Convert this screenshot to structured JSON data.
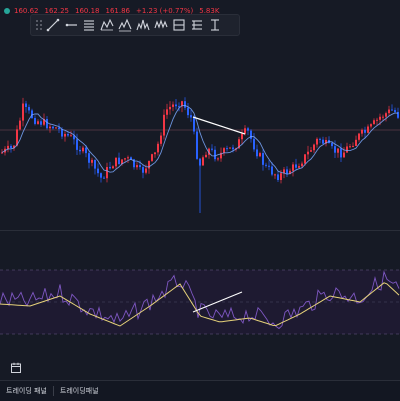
{
  "colors": {
    "background": "#161a25",
    "up": "#f23645",
    "down": "#2962ff",
    "ma": "#7ba9ff",
    "rsi": "#7e57c2",
    "rsi_ma": "#e6d27a",
    "trendline": "#ffffff"
  },
  "ohlc": {
    "status_dot_color": "#26a69a",
    "open": "160.62",
    "high": "162.25",
    "low": "160.18",
    "close": "161.86",
    "change": "+1.23 (+0.77%)",
    "volume": "5.83K"
  },
  "toolbar": {
    "tools": [
      {
        "name": "trendline-tool-icon"
      },
      {
        "name": "horizontal-ray-tool-icon"
      },
      {
        "name": "fibonacci-tool-icon"
      },
      {
        "name": "pattern-tool-icon"
      },
      {
        "name": "elliott-wave-tool-icon"
      },
      {
        "name": "head-shoulders-tool-icon"
      },
      {
        "name": "wave-pattern-tool-icon"
      },
      {
        "name": "long-position-tool-icon"
      },
      {
        "name": "forecast-tool-icon"
      },
      {
        "name": "range-tool-icon"
      }
    ]
  },
  "tabs": [
    "트레이딩 패널",
    "트레이딩패널"
  ]
}
